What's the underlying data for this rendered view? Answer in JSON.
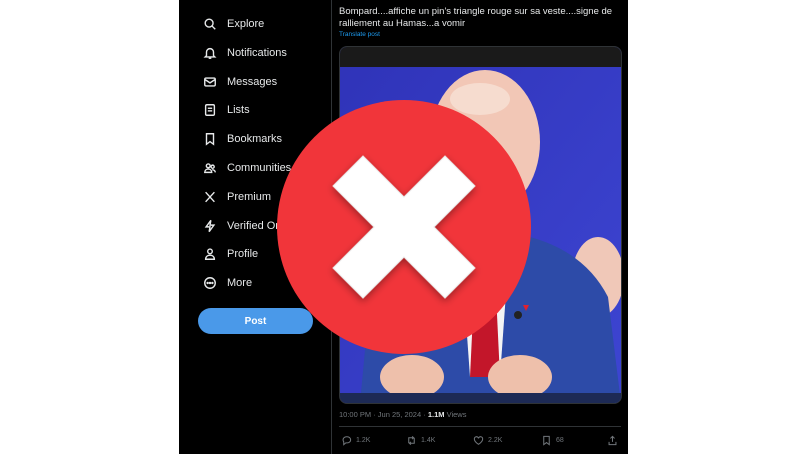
{
  "sidebar": {
    "items": [
      {
        "label": "Explore",
        "icon": "search-icon"
      },
      {
        "label": "Notifications",
        "icon": "bell-icon"
      },
      {
        "label": "Messages",
        "icon": "envelope-icon"
      },
      {
        "label": "Lists",
        "icon": "list-icon"
      },
      {
        "label": "Bookmarks",
        "icon": "bookmark-icon"
      },
      {
        "label": "Communities",
        "icon": "people-icon"
      },
      {
        "label": "Premium",
        "icon": "x-logo-icon"
      },
      {
        "label": "Verified Orgs",
        "icon": "lightning-icon"
      },
      {
        "label": "Profile",
        "icon": "person-icon"
      },
      {
        "label": "More",
        "icon": "more-circle-icon"
      }
    ],
    "post_label": "Post"
  },
  "tweet": {
    "text": "Bompard....affiche un pin's triangle rouge sur sa veste....signe de ralliement au Hamas...a vomir",
    "translate_label": "Translate post",
    "time": "10:00 PM · Jun 25, 2024 · ",
    "views_count": "1.1M",
    "views_label": " Views",
    "actions": {
      "replies": "1.2K",
      "reposts": "1.4K",
      "likes": "2.2K",
      "bookmarks": "68"
    }
  },
  "overlay": {
    "icon": "red-x-circle-icon",
    "color": "#f1353a"
  },
  "colors": {
    "background": "#000000",
    "accent": "#1d9bf0",
    "post_button": "#4a99e9",
    "text": "#e7e9ea",
    "muted": "#71767b"
  }
}
